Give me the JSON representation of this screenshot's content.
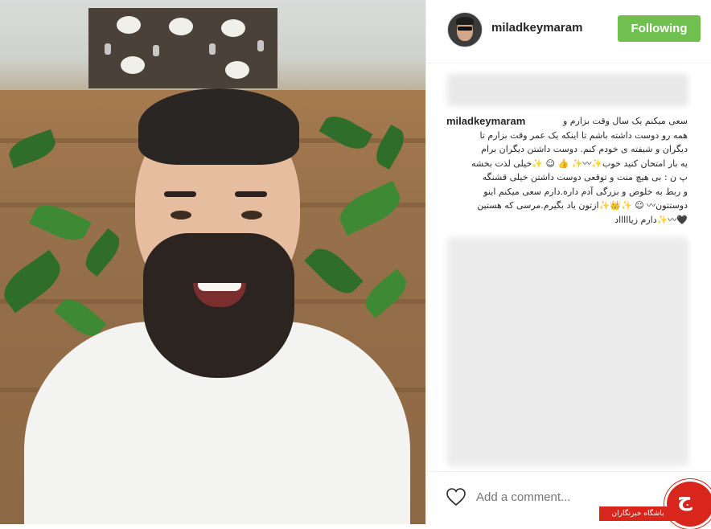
{
  "post": {
    "username": "miladkeymaram",
    "follow_button_label": "Following",
    "caption_lines": [
      "سعی میکنم یک سال وقت بزارم و",
      "همه رو دوست داشته باشم تا اینکه یک عمر وقت بزارم تا",
      "دیگران و شیفته ی خودم کنم. دوست داشتن دیگران برام",
      "یه بار امتحان کنید خوب✨〰✨ 👍 ☺ ✨خیلی لذت بخشه",
      "پ ن : بی هیچ منت و توقعی دوست داشتن خیلی قشنگه",
      "و ربط به خلوص و بزرگی آدم داره.دارم سعی میکنم اینو",
      "دوستتون〰 ☺ ✨👑✨ازتون یاد بگیرم.مرسی که هستین",
      "🖤〰✨دارم زیاااااد"
    ]
  },
  "comment": {
    "placeholder": "Add a comment..."
  },
  "icons": {
    "like": "heart-outline-icon"
  },
  "watermark": {
    "text": "باشگاه خبرنگاران",
    "glyph": "ج"
  },
  "colors": {
    "follow_green": "#70c050",
    "watermark_red": "#d9261c"
  }
}
